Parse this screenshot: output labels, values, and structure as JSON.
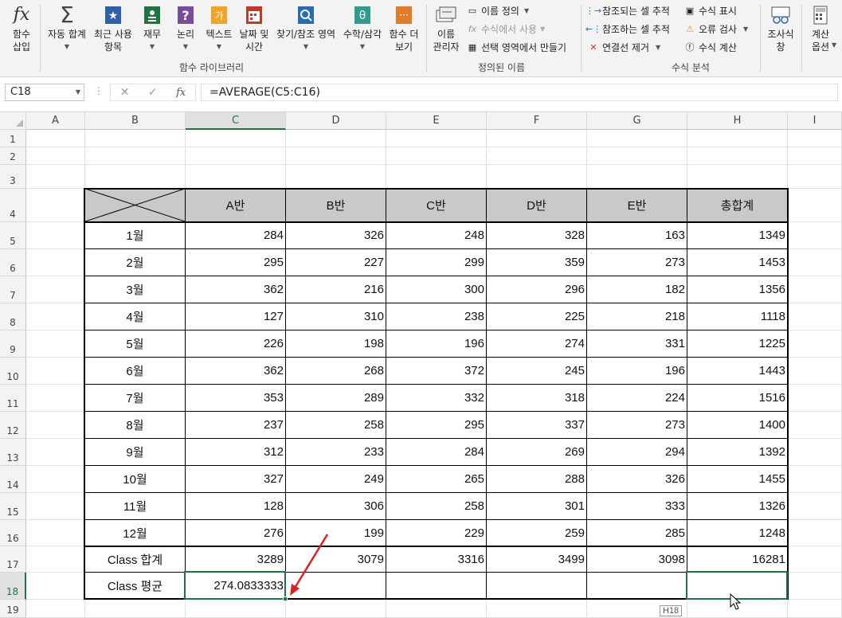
{
  "ribbon": {
    "insert_function": "함수\n삽입",
    "autosum": "자동 합계",
    "recent": "최근 사용\n항목",
    "financial": "재무",
    "logical": "논리",
    "text": "텍스트",
    "datetime": "날짜 및\n시간",
    "lookup": "찾기/참조 영역",
    "math": "수학/삼각",
    "more": "함수 더\n보기",
    "function_library_label": "함수 라이브러리",
    "name_manager": "이름\n관리자",
    "define_name": "이름 정의",
    "use_in_formula": "수식에서 사용",
    "create_from_selection": "선택 영역에서 만들기",
    "defined_names_label": "정의된 이름",
    "trace_precedents": "참조되는 셀 추적",
    "trace_dependents": "참조하는 셀 추적",
    "remove_arrows": "연결선 제거",
    "show_formulas": "수식 표시",
    "error_checking": "오류 검사",
    "evaluate_formula": "수식 계산",
    "formula_auditing_label": "수식 분석",
    "watch_window": "조사식\n창",
    "calc_options": "계산\n옵션",
    "colors": {
      "financial": "#217346",
      "logical": "#7b4b9c",
      "text": "#f0a428",
      "datetime": "#c0392b",
      "lookup": "#2b6cb0",
      "math": "#2f9a8f",
      "more": "#e07b2a"
    }
  },
  "formula_bar": {
    "name_box": "C18",
    "fx": "fx",
    "formula": "=AVERAGE(C5:C16)"
  },
  "columns": [
    "A",
    "B",
    "C",
    "D",
    "E",
    "F",
    "G",
    "H",
    "I"
  ],
  "rows": [
    "1",
    "2",
    "3",
    "4",
    "5",
    "6",
    "7",
    "8",
    "9",
    "10",
    "11",
    "12",
    "13",
    "14",
    "15",
    "16",
    "17",
    "18",
    "19"
  ],
  "table": {
    "headers": [
      "A반",
      "B반",
      "C반",
      "D반",
      "E반",
      "총합계"
    ],
    "months": [
      "1월",
      "2월",
      "3월",
      "4월",
      "5월",
      "6월",
      "7월",
      "8월",
      "9월",
      "10월",
      "11월",
      "12월"
    ],
    "values": [
      [
        "284",
        "326",
        "248",
        "328",
        "163",
        "1349"
      ],
      [
        "295",
        "227",
        "299",
        "359",
        "273",
        "1453"
      ],
      [
        "362",
        "216",
        "300",
        "296",
        "182",
        "1356"
      ],
      [
        "127",
        "310",
        "238",
        "225",
        "218",
        "1118"
      ],
      [
        "226",
        "198",
        "196",
        "274",
        "331",
        "1225"
      ],
      [
        "362",
        "268",
        "372",
        "245",
        "196",
        "1443"
      ],
      [
        "353",
        "289",
        "332",
        "318",
        "224",
        "1516"
      ],
      [
        "237",
        "258",
        "295",
        "337",
        "273",
        "1400"
      ],
      [
        "312",
        "233",
        "284",
        "269",
        "294",
        "1392"
      ],
      [
        "327",
        "249",
        "265",
        "288",
        "326",
        "1455"
      ],
      [
        "128",
        "306",
        "258",
        "301",
        "333",
        "1326"
      ],
      [
        "276",
        "199",
        "229",
        "259",
        "285",
        "1248"
      ]
    ],
    "total_label": "Class 합계",
    "totals": [
      "3289",
      "3079",
      "3316",
      "3499",
      "3098",
      "16281"
    ],
    "avg_label": "Class 평균",
    "avg_c": "274.0833333"
  },
  "tooltip": "H18",
  "accent": "#217346",
  "arrow_color": "#e02020"
}
